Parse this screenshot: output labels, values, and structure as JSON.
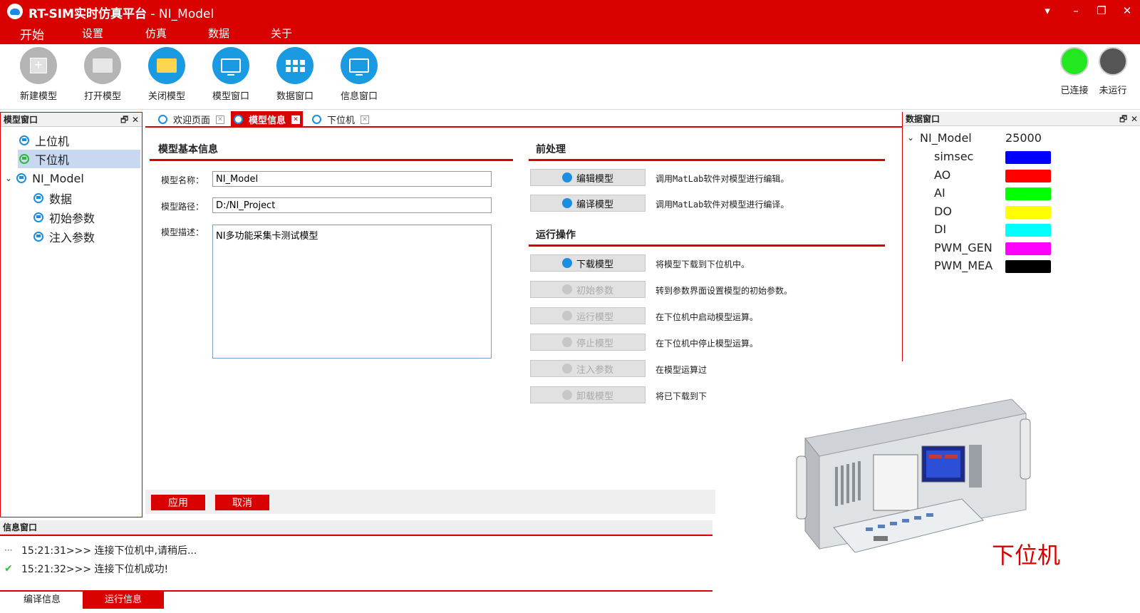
{
  "window": {
    "title_app": "RT-SIM实时仿真平台",
    "title_sep": " - ",
    "title_doc": "NI_Model",
    "controls": [
      "▾",
      "–",
      "❐",
      "✕"
    ]
  },
  "menu": [
    "开始",
    "设置",
    "仿真",
    "数据",
    "关于"
  ],
  "ribbon": {
    "buttons": [
      {
        "label": "新建模型",
        "icon": "new-file-icon"
      },
      {
        "label": "打开模型",
        "icon": "folder-open-icon"
      },
      {
        "label": "关闭模型",
        "icon": "folder-close-icon"
      },
      {
        "label": "模型窗口",
        "icon": "model-window-icon"
      },
      {
        "label": "数据窗口",
        "icon": "data-window-icon"
      },
      {
        "label": "信息窗口",
        "icon": "info-window-icon"
      }
    ],
    "status": [
      {
        "label": "已连接",
        "color": "#22e822"
      },
      {
        "label": "未运行",
        "color": "#555555"
      }
    ]
  },
  "left_panel": {
    "title": "模型窗口",
    "pin": "🗗",
    "close": "✕",
    "tree": [
      {
        "label": "上位机",
        "level": 1
      },
      {
        "label": "下位机",
        "level": 1,
        "selected": true
      },
      {
        "label": "NI_Model",
        "level": 0,
        "expanded": true
      },
      {
        "label": "数据",
        "level": 2
      },
      {
        "label": "初始参数",
        "level": 2
      },
      {
        "label": "注入参数",
        "level": 2
      }
    ]
  },
  "tabs": [
    {
      "label": "欢迎页面"
    },
    {
      "label": "模型信息",
      "active": true
    },
    {
      "label": "下位机"
    }
  ],
  "model_info": {
    "section_title": "模型基本信息",
    "name_label": "模型名称：",
    "name_value": "NI_Model",
    "path_label": "模型路径：",
    "path_value": "D:/NI_Project",
    "desc_label": "模型描述：",
    "desc_value": "NI多功能采集卡测试模型"
  },
  "preprocess": {
    "section_title": "前处理",
    "items": [
      {
        "button": "编辑模型",
        "desc": "调用MatLab软件对模型进行编辑。",
        "enabled": true
      },
      {
        "button": "编译模型",
        "desc": "调用MatLab软件对模型进行编译。",
        "enabled": true
      }
    ]
  },
  "run_ops": {
    "section_title": "运行操作",
    "items": [
      {
        "button": "下载模型",
        "desc": "将模型下载到下位机中。",
        "enabled": true
      },
      {
        "button": "初始参数",
        "desc": "转到参数界面设置模型的初始参数。",
        "enabled": false
      },
      {
        "button": "运行模型",
        "desc": "在下位机中启动模型运算。",
        "enabled": false
      },
      {
        "button": "停止模型",
        "desc": "在下位机中停止模型运算。",
        "enabled": false
      },
      {
        "button": "注入参数",
        "desc": "在模型运算过",
        "enabled": false
      },
      {
        "button": "卸载模型",
        "desc": "将已下载到下",
        "enabled": false
      }
    ]
  },
  "actions": {
    "apply": "应用",
    "cancel": "取消"
  },
  "data_panel": {
    "title": "数据窗口",
    "pin": "🗗",
    "close": "✕",
    "root": {
      "name": "NI_Model",
      "value": "25000"
    },
    "signals": [
      {
        "name": "simsec",
        "color": "#0000ff"
      },
      {
        "name": "AO",
        "color": "#ff0000"
      },
      {
        "name": "AI",
        "color": "#00ff00"
      },
      {
        "name": "DO",
        "color": "#ffff00"
      },
      {
        "name": "DI",
        "color": "#00ffff"
      },
      {
        "name": "PWM_GEN",
        "color": "#ff00ff"
      },
      {
        "name": "PWM_MEA",
        "color": "#000000"
      }
    ]
  },
  "info_panel": {
    "title": "信息窗口",
    "logs": [
      {
        "icon": "ellipsis-icon",
        "glyph": "···",
        "text": "15:21:31>>> 连接下位机中,请稍后..."
      },
      {
        "icon": "check-icon",
        "glyph": "✔",
        "text": "15:21:32>>> 连接下位机成功!"
      }
    ],
    "tabs": [
      {
        "label": "编译信息"
      },
      {
        "label": "运行信息",
        "active": true
      }
    ]
  },
  "overlay": {
    "caption": "下位机"
  },
  "colors": {
    "brand_red": "#d90000",
    "accent_blue": "#1a8ee0"
  }
}
